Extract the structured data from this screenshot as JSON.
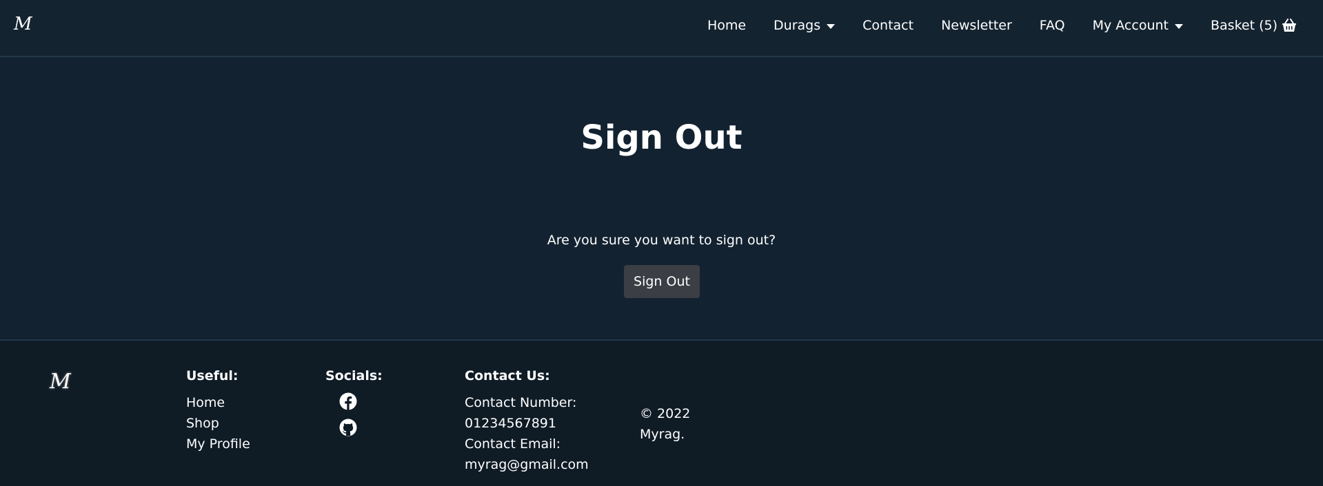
{
  "navbar": {
    "brand": "M",
    "items": [
      {
        "label": "Home"
      },
      {
        "label": "Durags"
      },
      {
        "label": "Contact"
      },
      {
        "label": "Newsletter"
      },
      {
        "label": "FAQ"
      },
      {
        "label": "My Account"
      },
      {
        "label": "Basket (5)"
      }
    ]
  },
  "main": {
    "title": "Sign Out",
    "confirm_text": "Are you sure you want to sign out?",
    "button_label": "Sign Out"
  },
  "footer": {
    "brand": "M",
    "useful": {
      "heading": "Useful:",
      "links": [
        "Home",
        "Shop",
        "My Profile"
      ]
    },
    "socials": {
      "heading": "Socials:",
      "icons": [
        "facebook-icon",
        "github-icon"
      ]
    },
    "contact": {
      "heading": "Contact Us:",
      "number_label": "Contact Number:",
      "number": "01234567891",
      "email_label": "Contact Email:",
      "email": "myrag@gmail.com"
    },
    "copyright_line1": "© 2022",
    "copyright_line2": "Myrag."
  },
  "colors": {
    "background": "#132230",
    "footer_background": "#0f1b25",
    "button": "#3b3f45",
    "text": "#ffffff"
  }
}
